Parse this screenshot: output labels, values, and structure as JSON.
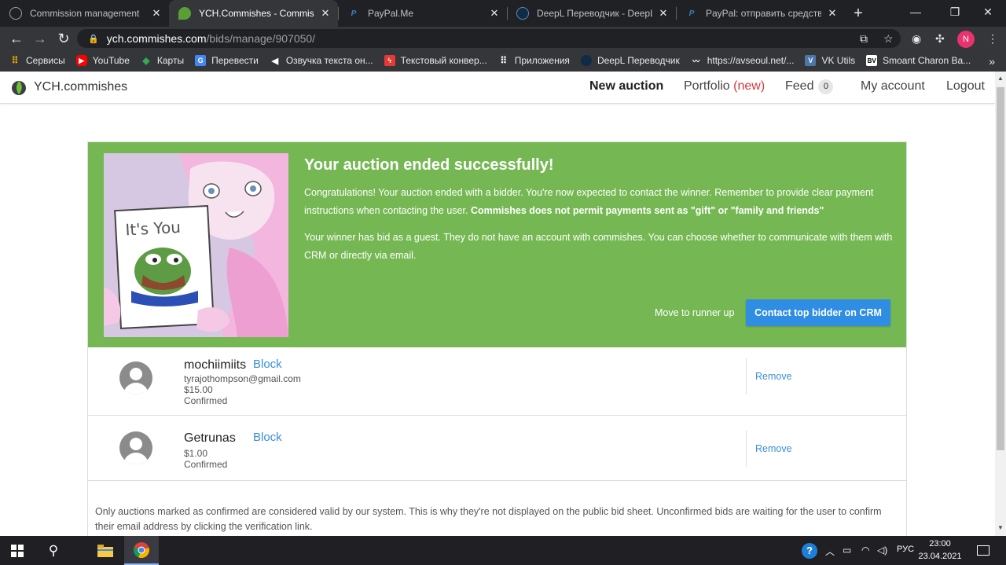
{
  "browser": {
    "tabs": [
      {
        "title": "Commission management",
        "active": false,
        "icon": "globe-icon"
      },
      {
        "title": "YCH.Commishes - Commissions",
        "active": true,
        "icon": "ych-leaf-icon"
      },
      {
        "title": "PayPal.Me",
        "active": false,
        "icon": "paypal-icon"
      },
      {
        "title": "DeepL Переводчик - DeepL Translate",
        "active": false,
        "icon": "deepl-icon"
      },
      {
        "title": "PayPal: отправить средства",
        "active": false,
        "icon": "paypal-icon"
      }
    ],
    "url_host": "ych.commishes.com",
    "url_path": "/bids/manage/907050/",
    "profile_initial": "N",
    "bookmarks": [
      "Сервисы",
      "YouTube",
      "Карты",
      "Перевести",
      "Озвучка текста он...",
      "Текстовый конвер...",
      "Приложения",
      "DeepL Переводчик",
      "https://avseoul.net/...",
      "VK Utils",
      "Smoant Charon Ba..."
    ]
  },
  "site": {
    "brand": "YCH.commishes",
    "nav": {
      "new_auction": "New auction",
      "portfolio": "Portfolio",
      "portfolio_tag": "(new)",
      "feed": "Feed",
      "feed_count": "0",
      "my_account": "My account",
      "logout": "Logout"
    }
  },
  "banner": {
    "title": "Your auction ended successfully!",
    "p1": "Congratulations! Your auction ended with a bidder. You're now expected to contact the winner. Remember to provide clear payment instructions when contacting the user. ",
    "p1_bold": "Commishes does not permit payments sent as \"gift\" or \"family and friends\"",
    "p2": "Your winner has bid as a guest. They do not have an account with commishes. You can choose whether to communicate with them with CRM or directly via email.",
    "runner_up": "Move to runner up",
    "contact_button": "Contact top bidder on CRM",
    "image_sign_text": "It's You"
  },
  "bids": [
    {
      "name": "mochiimiits",
      "block": "Block",
      "email": "tyrajothompson@gmail.com",
      "amount": "$15.00",
      "status": "Confirmed",
      "remove": "Remove"
    },
    {
      "name": "Getrunas",
      "block": "Block",
      "amount": "$1.00",
      "status": "Confirmed",
      "remove": "Remove"
    }
  ],
  "note": "Only auctions marked as confirmed are considered valid by our system. This is why they're not displayed on the public bid sheet. Unconfirmed bids are waiting for the user to confirm their email address by clicking the verification link.",
  "taskbar": {
    "lang": "РУС",
    "time": "23:00",
    "date": "23.04.2021"
  },
  "colors": {
    "banner_green": "#75b853",
    "primary_blue": "#2f8de4",
    "link_blue": "#3b8fd9",
    "new_red": "#d9363e"
  }
}
